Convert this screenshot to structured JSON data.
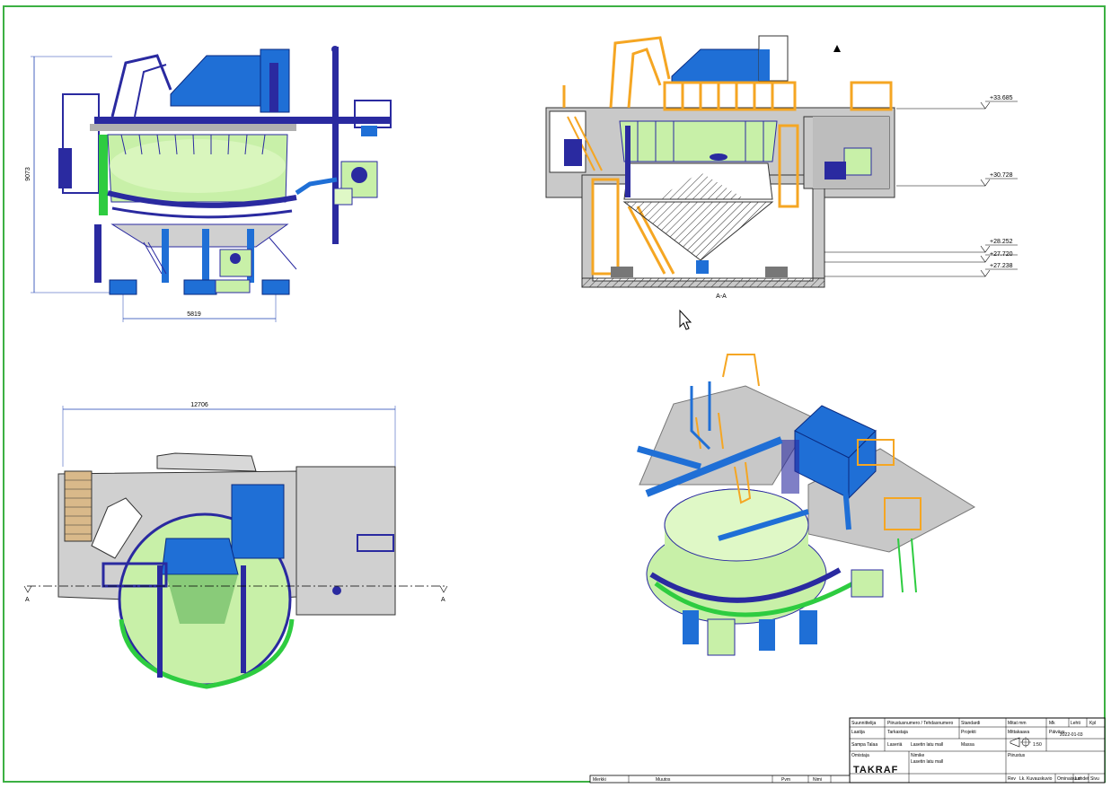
{
  "drawing": {
    "views": {
      "side_view": {
        "dim_height": "9073",
        "dim_width": "5819"
      },
      "section_view": {
        "section_label": "A-A",
        "levels": [
          "+33.685",
          "+30.728",
          "+28.252",
          "+27.720",
          "+27.238"
        ]
      },
      "plan_view": {
        "dim_width": "12706",
        "section_mark_left": "A",
        "section_mark_right": "A"
      }
    },
    "colors": {
      "frame_border": "#3cb043",
      "structure_blue": "#1f6fd6",
      "dark_blue": "#2a2aa0",
      "railing_orange": "#f5a623",
      "tank_green": "#c8f0a8",
      "floor_grey": "#c8c8c8",
      "pipe_green": "#2ecc40"
    },
    "title_block": {
      "logo": "TAKRAF",
      "r1": [
        "Suunnittelija",
        "Piirustusnumero / Tehdasnumero",
        "Standardi",
        "Mitat mm",
        "Mk",
        "Lehti",
        "Kpl"
      ],
      "r2": [
        "Laatija",
        "Tarkastaja",
        "Projekti",
        "Mittakaava",
        "Päiväys"
      ],
      "r3": [
        "Sampa Talaa",
        "Laseriä",
        "Lasetin latu mall",
        "Massa",
        "1:50",
        "2022-01-03"
      ],
      "r4": [
        "Omistaja",
        "Nimike",
        "Lasetin latu mall",
        "Piirustus"
      ],
      "r5": [
        "Merkki",
        "Muutos",
        "Pvm",
        "Nimi",
        "Rev",
        "Lk. Kuvauskuvio",
        "Ominaisuus",
        "Lehdet",
        "Sivu"
      ]
    }
  }
}
